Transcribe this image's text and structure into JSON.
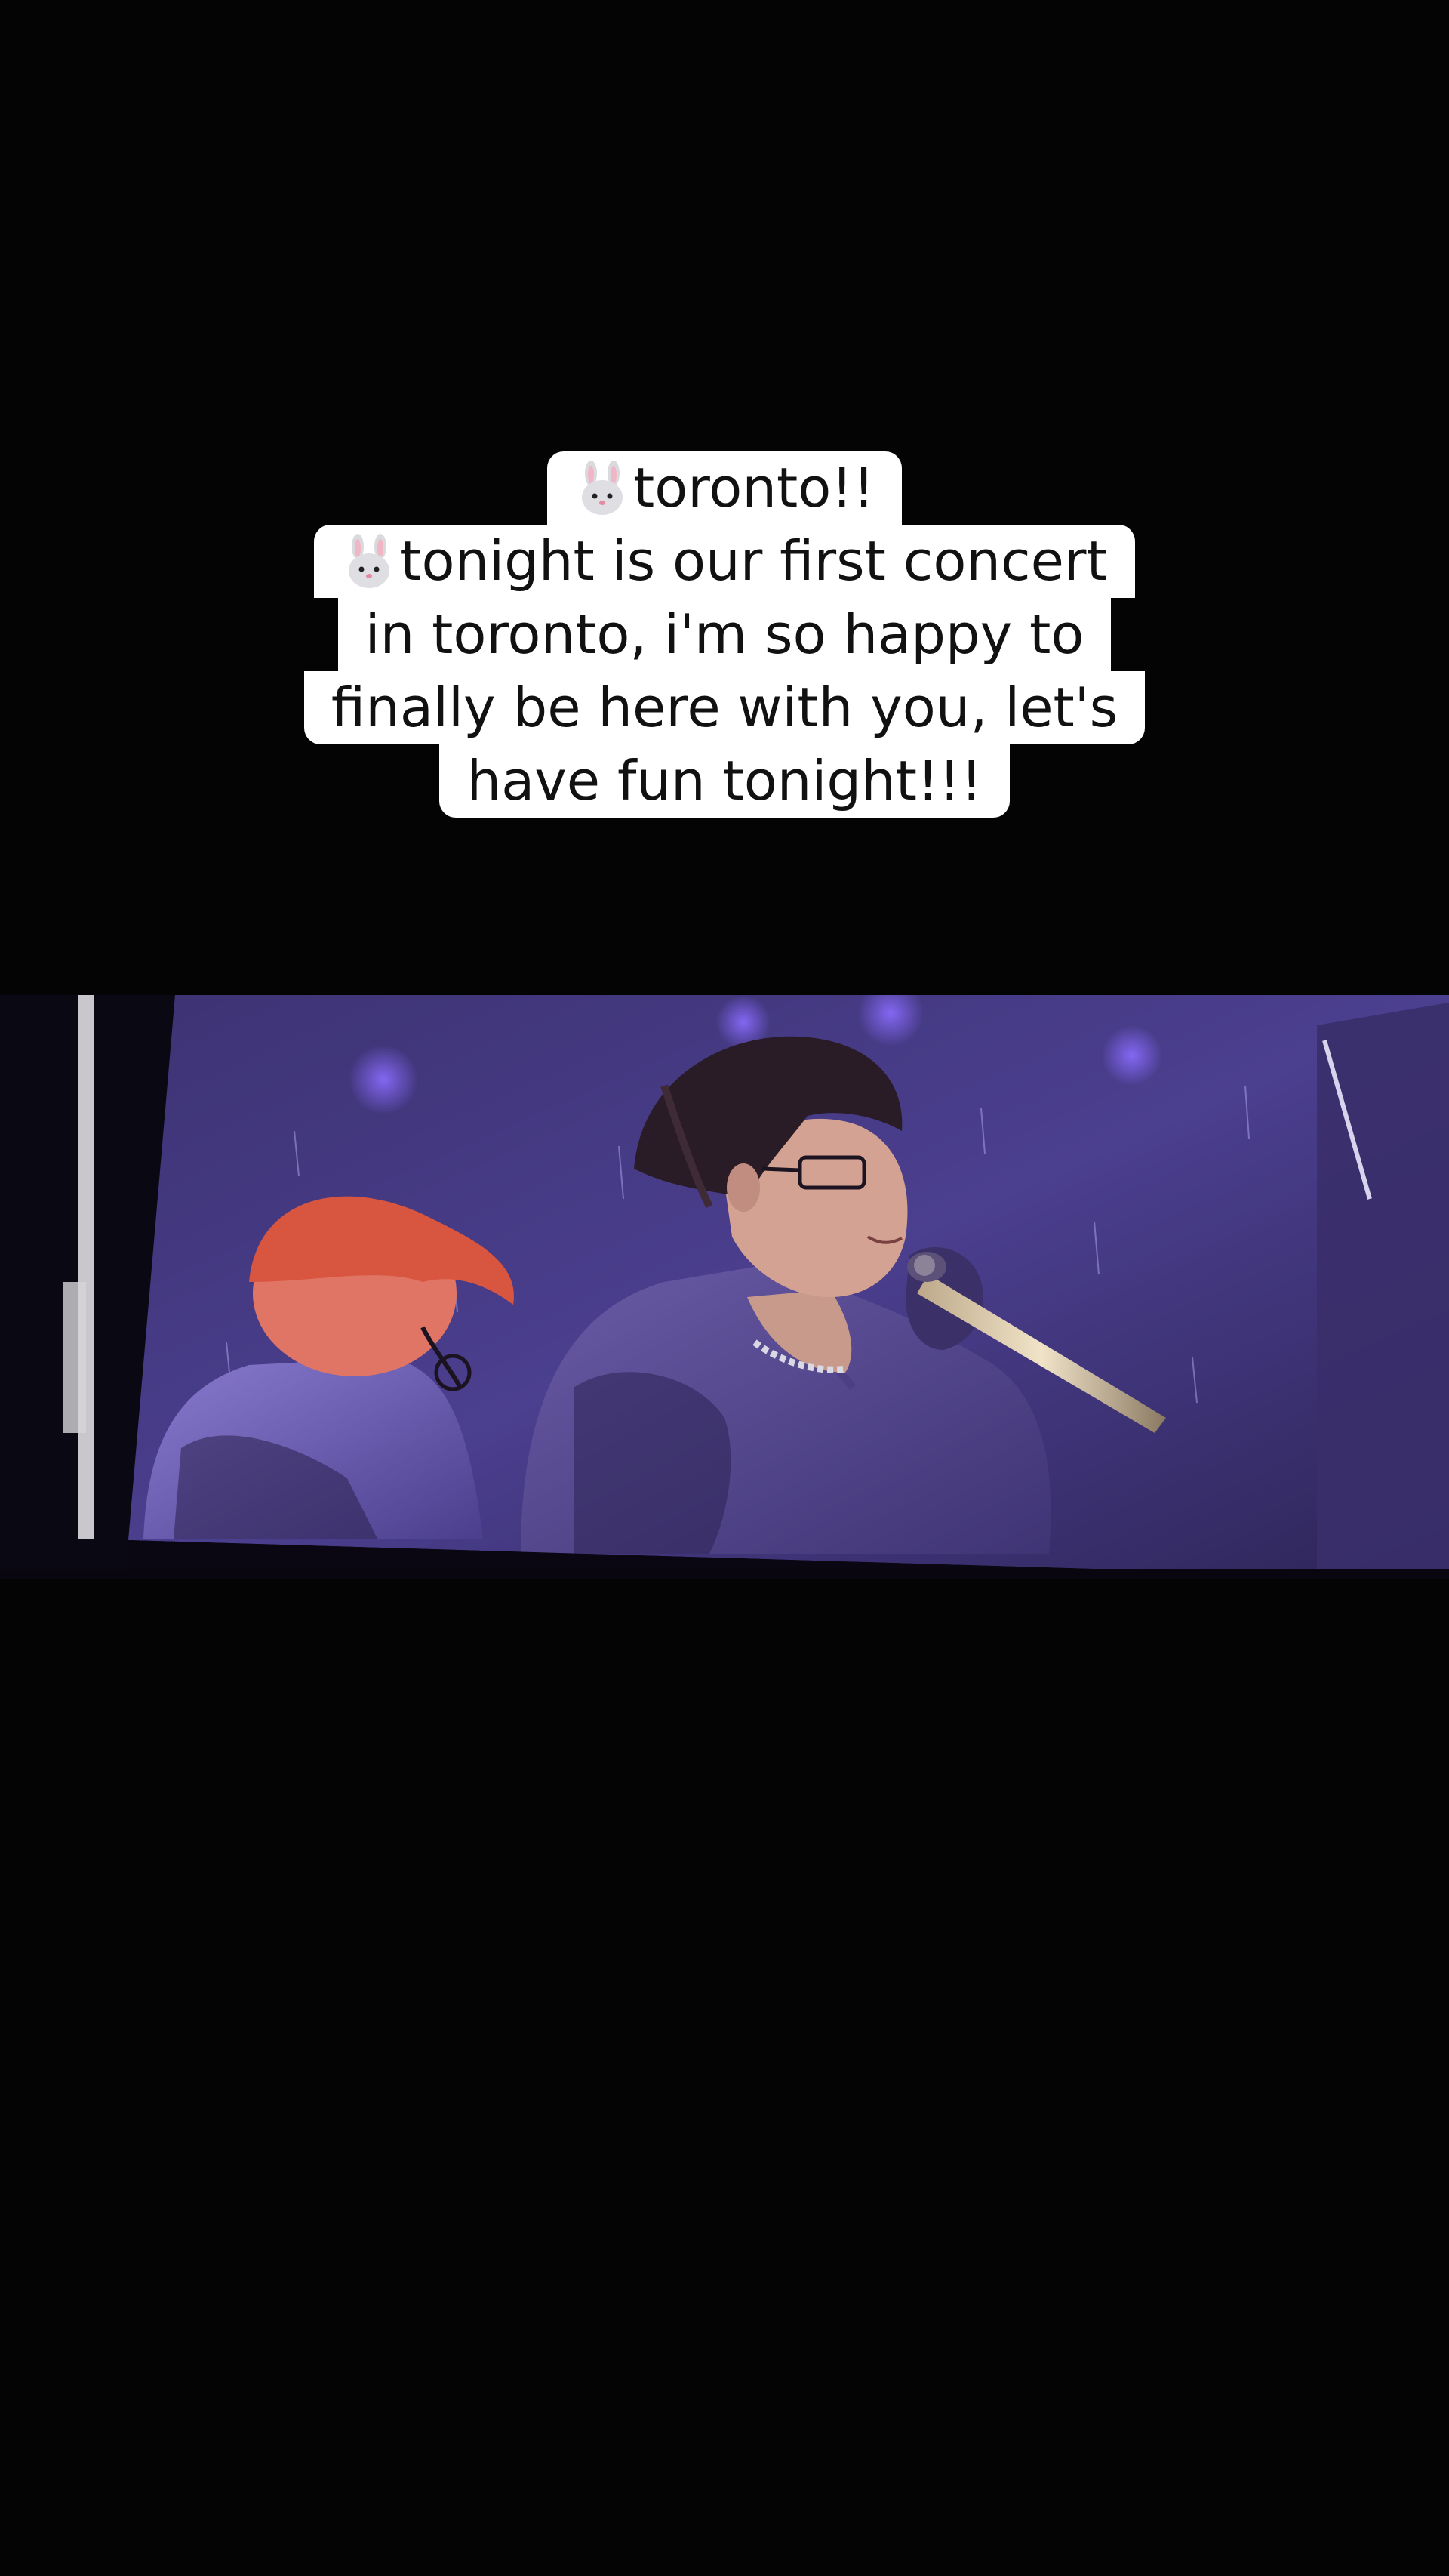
{
  "caption": {
    "lines": [
      "toronto!!",
      "tonight is our first concert",
      "in toronto, i'm so happy to",
      "finally be here with you, let's",
      "have fun tonight!!!"
    ],
    "emoji": "rabbit-face-icon"
  },
  "colors": {
    "background": "#040404",
    "caption_bg": "#ffffff",
    "caption_text": "#111111",
    "stage_purple": "#4a3c8c"
  }
}
